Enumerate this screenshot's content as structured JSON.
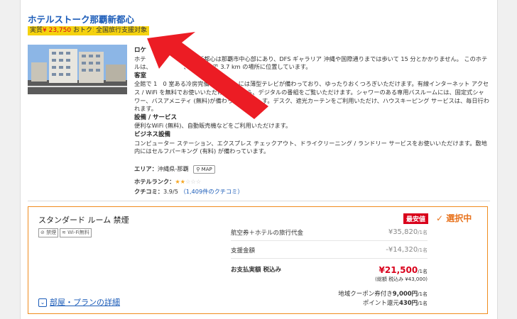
{
  "hotel": {
    "name": "ホテルストーク那覇新都心",
    "badge_price_prefix": "実質",
    "badge_price": "¥ 23,750",
    "badge_price_suffix": "おトク！",
    "badge_campaign": "全国旅行支援対象"
  },
  "description": {
    "location_heading": "ロケ",
    "location_text": "ホテ　　　　　　　那覇新都心は那覇市中心部にあり、DFS ギャラリア 沖縄や国際通りまでは歩いて 15 分とかかりません。 このホテルは、　　　　　　、首里城まで 3.7 km の場所に位置しています。",
    "room_heading": "客室",
    "room_text": "全館で 1　0 室ある冷房完備　　　　　には薄型テレビが備わっており、ゆったりおくつろぎいただけます。有線インターネット アクセス / WiFi を無料でお使いいただけます　から、デジタルの番組をご覧いただけます。シャワーのある専用バスルームには、固定式シャワー、バスアメニティ (無料)が備わっ　　　　　す。デスク、遮光カーテンをご利用いただけ、ハウスキーピング サービスは、毎日行われます。",
    "facility_heading": "設備 / サービス",
    "facility_text": "便利なWiFi (無料)、自動販売機などをご利用いただけます。",
    "business_heading": "ビジネス設備",
    "business_text": "コンピューター ステーション、エクスプレス チェックアウト、ドライクリーニング / ランドリー サービスをお使いいただけます。敷地内にはセルフパーキング (有料) が備わっています。"
  },
  "info": {
    "area_label": "エリア：",
    "area_value": "沖縄県-那覇",
    "map_button": "MAP",
    "rank_label": "ホテルランク：",
    "rating_label": "クチコミ：",
    "rating_value": "3.9",
    "rating_max": "/5",
    "review_count": "（1,409件のクチコミ）"
  },
  "room": {
    "name": "スタンダード ルーム 禁煙",
    "amenity_1": "禁煙",
    "amenity_2": "Wi-Fi無料",
    "cheapest_badge": "最安値",
    "selected_label": "選択中",
    "rows": [
      {
        "label": "航空券＋ホテルの旅行代金",
        "value": "¥35,820",
        "unit": "/1名"
      },
      {
        "label": "支援金額",
        "value": "-¥14,320",
        "unit": "/1名"
      },
      {
        "label": "お支払実額 税込み",
        "value": "¥21,500",
        "unit": "/1名"
      }
    ],
    "total_note": "(総額 税込み ¥43,000)",
    "coupon_label": "地域クーポン券付き",
    "coupon_value": "9,000円",
    "coupon_unit": "/1名",
    "points_label": "ポイント還元",
    "points_value": "430円",
    "points_unit": "/1名",
    "details_link": "部屋・プランの詳細"
  },
  "colors": {
    "accent_blue": "#1a5bb8",
    "orange": "#f08c1e",
    "red": "#d9001b",
    "yellow": "#f5d20f"
  }
}
